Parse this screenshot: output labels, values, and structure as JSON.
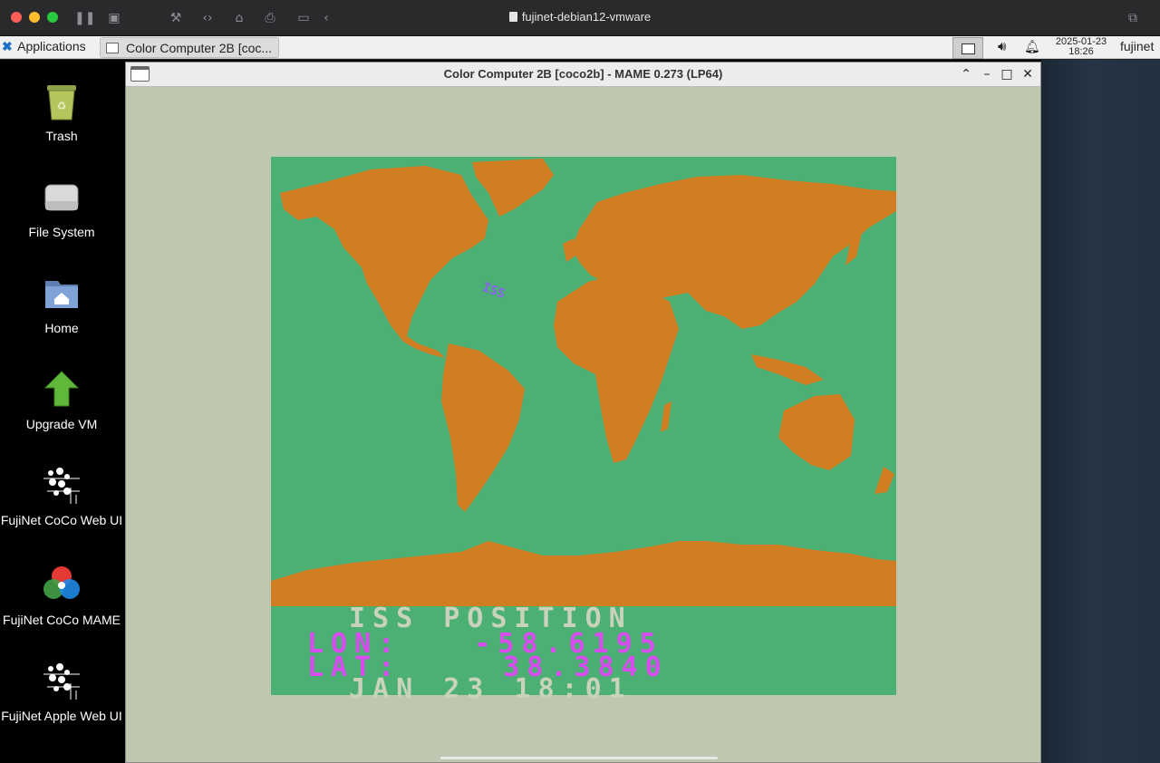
{
  "vm": {
    "title": "fujinet-debian12-vmware"
  },
  "panel": {
    "applications_label": "Applications",
    "task_button_label": "Color Computer 2B [coc...",
    "clock_date": "2025-01-23",
    "clock_time": "18:26",
    "user_label": "fujinet"
  },
  "desktop": {
    "icons": [
      {
        "label": "Trash"
      },
      {
        "label": "File System"
      },
      {
        "label": "Home"
      },
      {
        "label": "Upgrade VM"
      },
      {
        "label": "FujiNet CoCo Web UI"
      },
      {
        "label": "FujiNet CoCo MAME"
      },
      {
        "label": "FujiNet Apple Web UI"
      }
    ]
  },
  "mame": {
    "window_title": "Color Computer 2B [coco2b] - MAME 0.273 (LP64)",
    "screen": {
      "heading": "ISS POSITION",
      "lon_label": "LON:",
      "lon_value": "-58.6195",
      "lat_label": "LAT:",
      "lat_value": "38.3840",
      "timestamp": "JAN 23 18:01",
      "marker": "ISS"
    }
  },
  "colors": {
    "ocean": "#4caf73",
    "land": "#d17d22",
    "text_light": "#c9d3bb",
    "text_magenta": "#d84bf0",
    "window_bg": "#c0c7b0"
  }
}
